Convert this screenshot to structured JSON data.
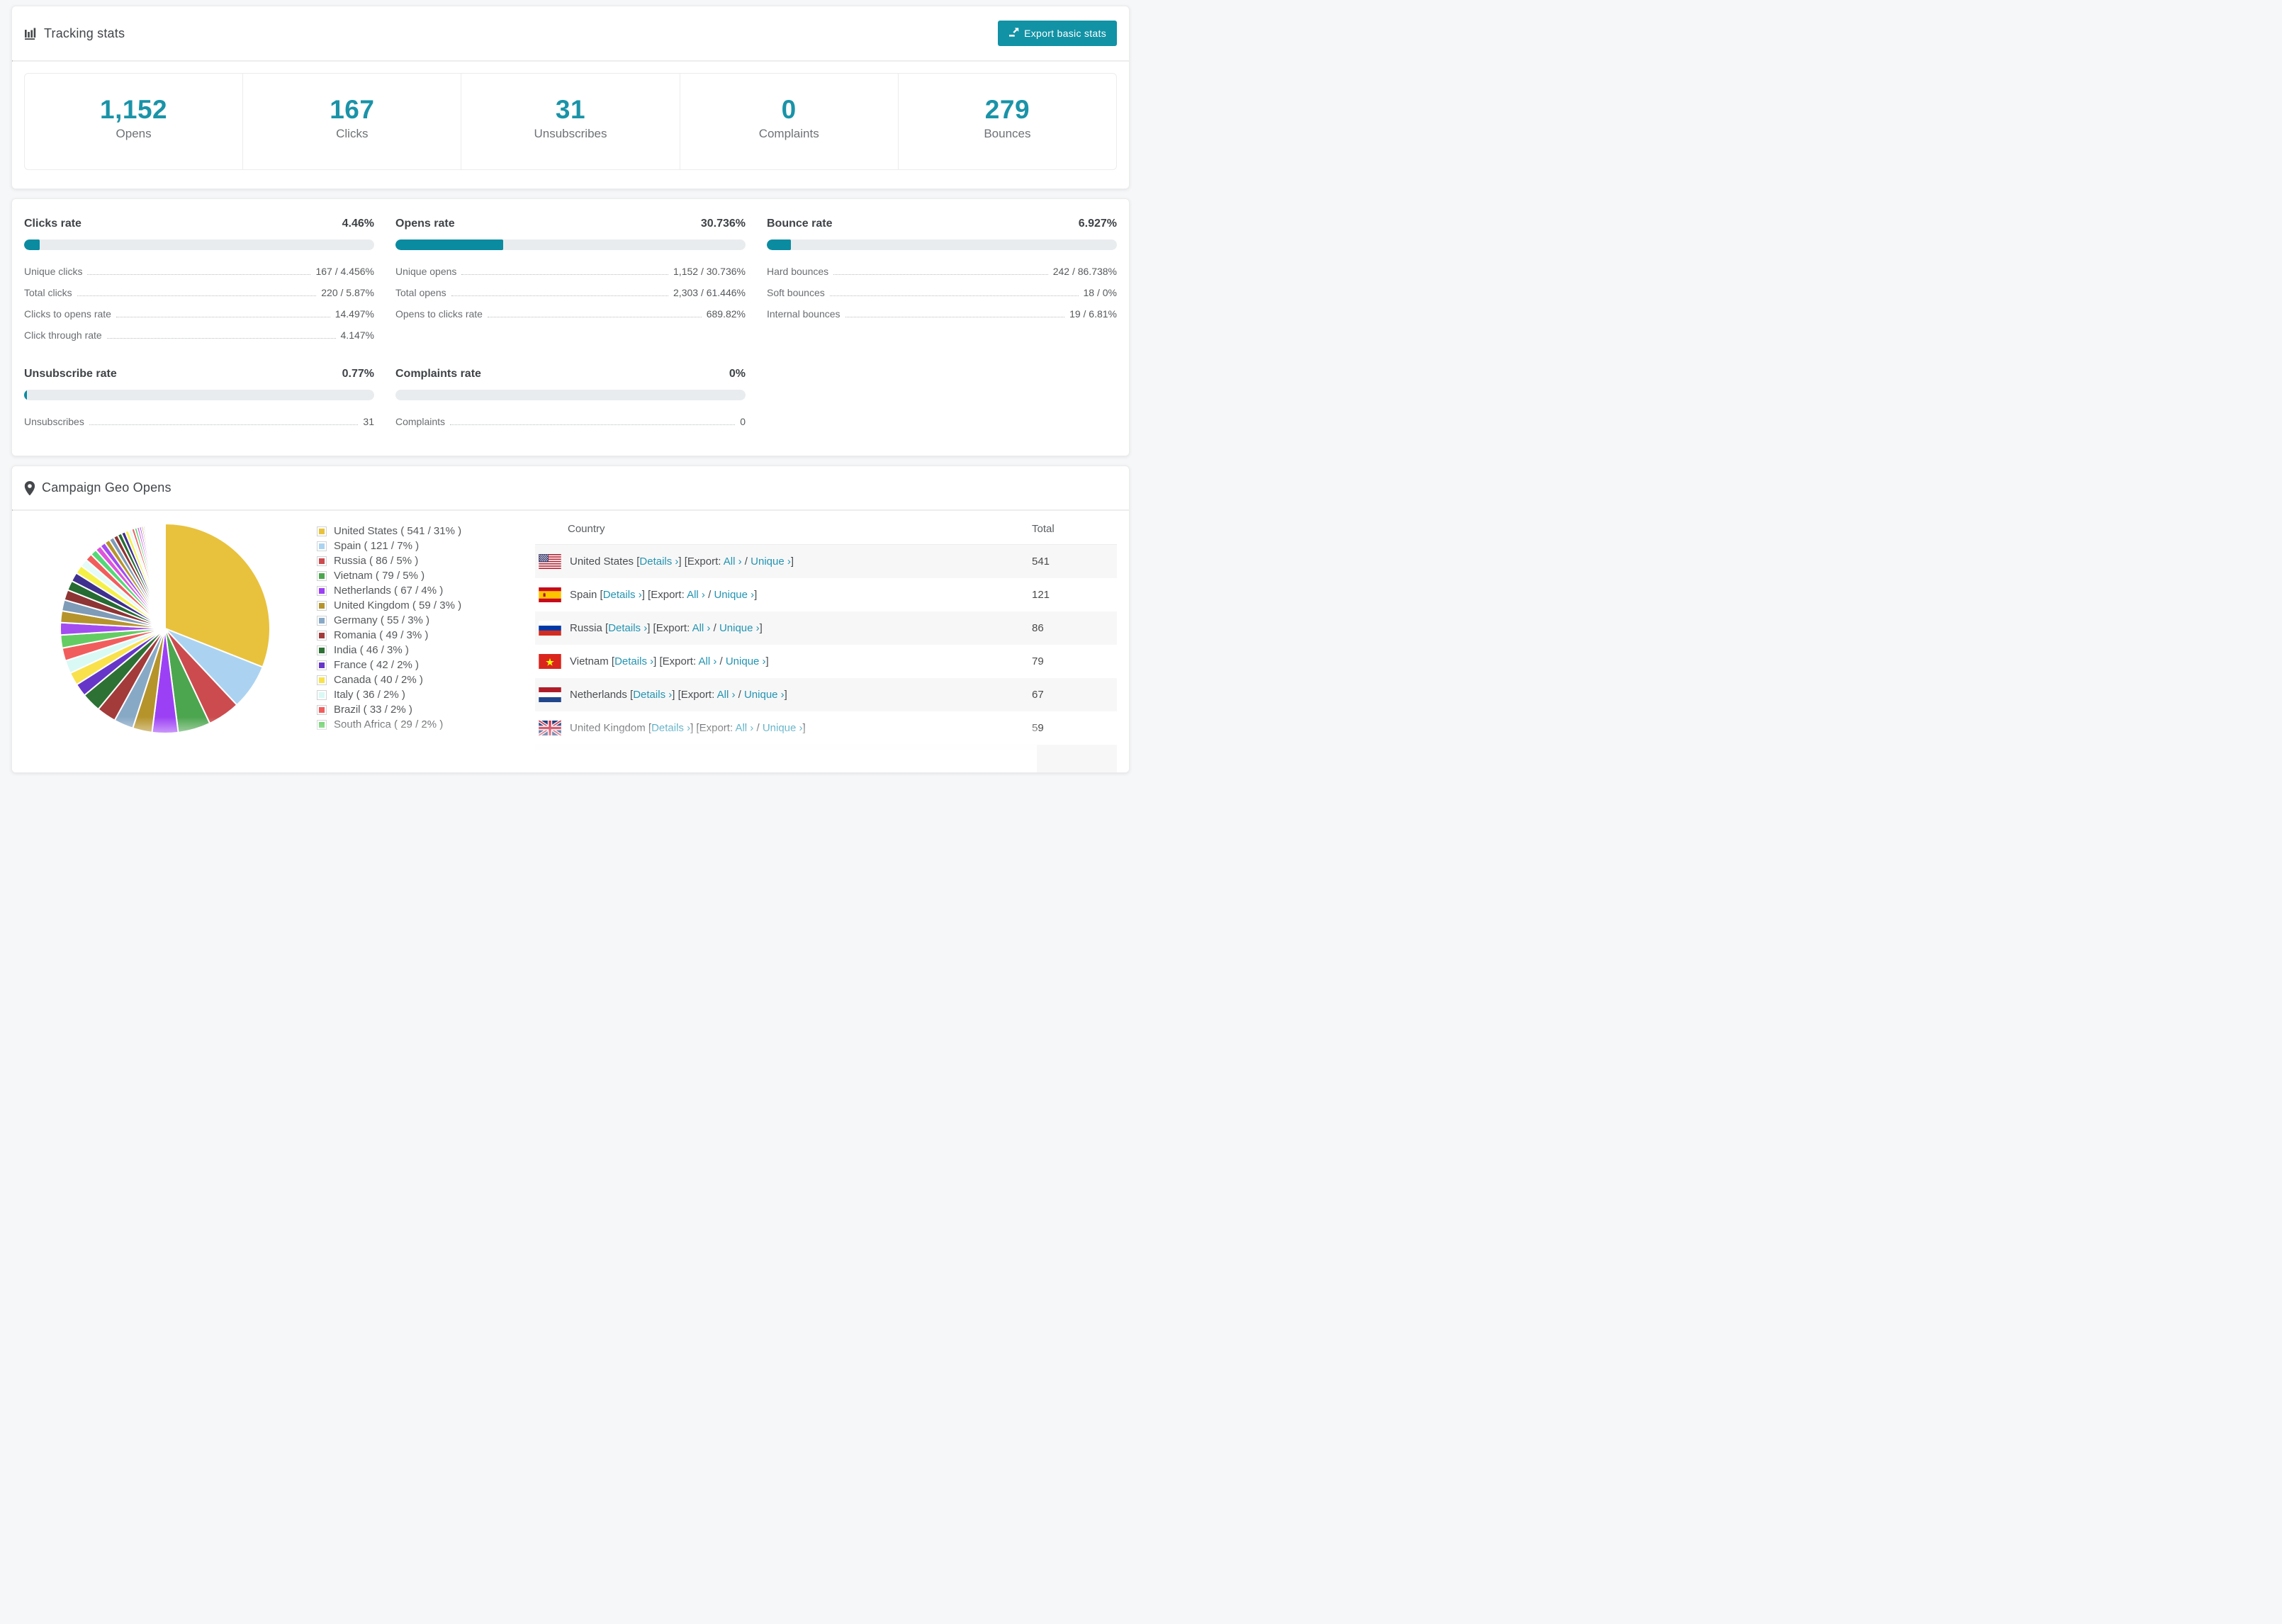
{
  "colors": {
    "accent_teal": "#1292A5",
    "bar_fill": "#0A8BA0",
    "stat_number_teal": "#1A93A8",
    "link_teal": "#2394B2",
    "row_stripe": "#F7F7F7"
  },
  "tracking": {
    "title": "Tracking stats",
    "export_button": "Export basic stats",
    "summary": [
      {
        "value": "1,152",
        "label": "Opens"
      },
      {
        "value": "167",
        "label": "Clicks"
      },
      {
        "value": "31",
        "label": "Unsubscribes"
      },
      {
        "value": "0",
        "label": "Complaints"
      },
      {
        "value": "279",
        "label": "Bounces"
      }
    ]
  },
  "rates": {
    "blocks": [
      {
        "title": "Clicks rate",
        "value": "4.46%",
        "bar_pct": 4.46,
        "rows": [
          {
            "label": "Unique clicks",
            "value": "167 / 4.456%"
          },
          {
            "label": "Total clicks",
            "value": "220 / 5.87%"
          },
          {
            "label": "Clicks to opens rate",
            "value": "14.497%"
          },
          {
            "label": "Click through rate",
            "value": "4.147%"
          }
        ]
      },
      {
        "title": "Opens rate",
        "value": "30.736%",
        "bar_pct": 30.736,
        "rows": [
          {
            "label": "Unique opens",
            "value": "1,152 / 30.736%"
          },
          {
            "label": "Total opens",
            "value": "2,303 / 61.446%"
          },
          {
            "label": "Opens to clicks rate",
            "value": "689.82%"
          }
        ]
      },
      {
        "title": "Bounce rate",
        "value": "6.927%",
        "bar_pct": 6.927,
        "rows": [
          {
            "label": "Hard bounces",
            "value": "242 / 86.738%"
          },
          {
            "label": "Soft bounces",
            "value": "18 / 0%"
          },
          {
            "label": "Internal bounces",
            "value": "19 / 6.81%"
          }
        ]
      },
      {
        "title": "Unsubscribe rate",
        "value": "0.77%",
        "bar_pct": 0.77,
        "rows": [
          {
            "label": "Unsubscribes",
            "value": "31"
          }
        ]
      },
      {
        "title": "Complaints rate",
        "value": "0%",
        "bar_pct": 0,
        "rows": [
          {
            "label": "Complaints",
            "value": "0"
          }
        ]
      }
    ]
  },
  "geo": {
    "title": "Campaign Geo Opens",
    "table": {
      "columns": [
        "Country",
        "Total"
      ],
      "link_labels": {
        "details": "Details ›",
        "export_prefix": "Export:",
        "all": "All ›",
        "unique": "Unique ›"
      },
      "rows": [
        {
          "country": "United States",
          "flag": "us",
          "total": "541"
        },
        {
          "country": "Spain",
          "flag": "es",
          "total": "121"
        },
        {
          "country": "Russia",
          "flag": "ru",
          "total": "86"
        },
        {
          "country": "Vietnam",
          "flag": "vn",
          "total": "79"
        },
        {
          "country": "Netherlands",
          "flag": "nl",
          "total": "67"
        },
        {
          "country": "United Kingdom",
          "flag": "uk",
          "total": "59"
        }
      ],
      "partial_row": {
        "flag": "de",
        "country": "",
        "total": ""
      }
    }
  },
  "chart_data": {
    "type": "pie",
    "title": "Campaign Geo Opens",
    "legend_position": "right",
    "start_angle_deg": -90,
    "direction": "clockwise",
    "series": [
      {
        "name": "United States",
        "value": 541,
        "pct": 31,
        "color": "#E8C23D"
      },
      {
        "name": "Spain",
        "value": 121,
        "pct": 7,
        "color": "#ABD3F1"
      },
      {
        "name": "Russia",
        "value": 86,
        "pct": 5,
        "color": "#CC4B4E"
      },
      {
        "name": "Vietnam",
        "value": 79,
        "pct": 5,
        "color": "#4CA64F"
      },
      {
        "name": "Netherlands",
        "value": 67,
        "pct": 4,
        "color": "#9C40F5"
      },
      {
        "name": "United Kingdom",
        "value": 59,
        "pct": 3,
        "color": "#B6942C"
      },
      {
        "name": "Germany",
        "value": 55,
        "pct": 3,
        "color": "#88A9C6"
      },
      {
        "name": "Romania",
        "value": 49,
        "pct": 3,
        "color": "#A33B3B"
      },
      {
        "name": "India",
        "value": 46,
        "pct": 3,
        "color": "#2E7134"
      },
      {
        "name": "France",
        "value": 42,
        "pct": 2,
        "color": "#6636C9"
      },
      {
        "name": "Canada",
        "value": 40,
        "pct": 2,
        "color": "#F8E14B"
      },
      {
        "name": "Italy",
        "value": 36,
        "pct": 2,
        "color": "#D9F9F5"
      },
      {
        "name": "Brazil",
        "value": 33,
        "pct": 2,
        "color": "#F15D5D"
      },
      {
        "name": "South Africa",
        "value": 29,
        "pct": 2,
        "color": "#63CD63"
      }
    ],
    "legend_label_format": "{name} ( {value} / {pct}% )",
    "others_estimated": {
      "note": "unlabeled small-country slices fanning to slivers",
      "pcts": [
        1.9,
        1.8,
        1.7,
        1.6,
        1.5,
        1.4,
        1.3,
        1.2,
        1.1,
        1.0,
        0.9,
        0.85,
        0.8,
        0.75,
        0.7,
        0.65,
        0.6,
        0.55,
        0.5,
        0.45,
        0.4,
        0.36,
        0.32,
        0.28,
        0.25,
        0.22,
        0.19,
        0.16,
        0.14,
        0.12,
        0.1,
        0.09,
        0.08,
        0.07,
        0.06,
        0.05,
        0.04,
        0.03,
        0.03,
        0.02
      ],
      "palette": [
        "#A34DF0",
        "#B6942C",
        "#7E9BB8",
        "#8E3434",
        "#256B32",
        "#3F2F8E",
        "#F5F048",
        "#E4FBF8",
        "#F15D5D",
        "#55D878",
        "#DD55DD"
      ]
    }
  }
}
